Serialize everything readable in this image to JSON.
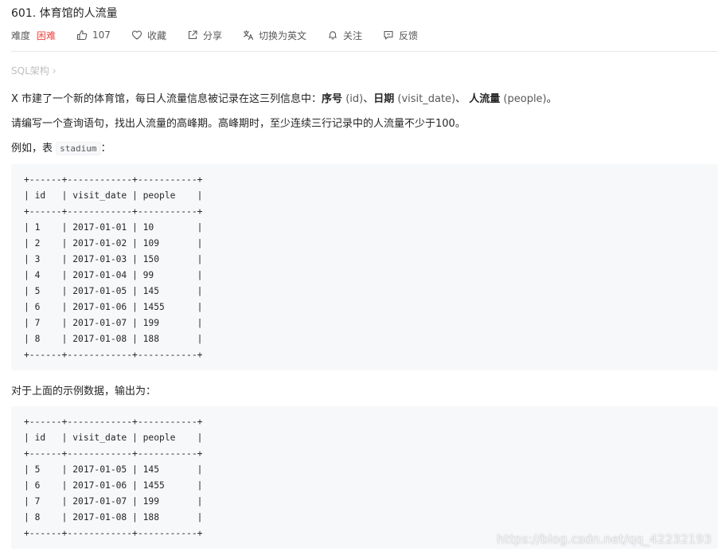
{
  "problem": {
    "title": "601. 体育馆的人流量",
    "difficulty_label": "难度",
    "difficulty_value": "困难",
    "likes": "107",
    "actions": {
      "favorite": "收藏",
      "share": "分享",
      "switch_language": "切换为英文",
      "follow": "关注",
      "feedback": "反馈"
    }
  },
  "breadcrumb": {
    "label": "SQL架构",
    "chevron": "›"
  },
  "description": {
    "p1_prefix": "X 市建了一个新的体育馆，每日人流量信息被记录在这三列信息中：",
    "p1_term1": "序号",
    "p1_term1_paren": " (id)",
    "p1_sep1": "、",
    "p1_term2": "日期",
    "p1_term2_paren": " (visit_date)",
    "p1_sep2": "、 ",
    "p1_term3": "人流量",
    "p1_term3_paren": " (people)",
    "p1_end": "。",
    "p2": "请编写一个查询语句，找出人流量的高峰期。高峰期时，至少连续三行记录中的人流量不少于100。",
    "p3_prefix": "例如，表 ",
    "p3_code": "stadium",
    "p3_suffix": "：",
    "p4": "对于上面的示例数据，输出为："
  },
  "example_table": {
    "text": "+------+------------+-----------+\n| id   | visit_date | people    |\n+------+------------+-----------+\n| 1    | 2017-01-01 | 10        |\n| 2    | 2017-01-02 | 109       |\n| 3    | 2017-01-03 | 150       |\n| 4    | 2017-01-04 | 99        |\n| 5    | 2017-01-05 | 145       |\n| 6    | 2017-01-06 | 1455      |\n| 7    | 2017-01-07 | 199       |\n| 8    | 2017-01-08 | 188       |\n+------+------------+-----------+"
  },
  "output_table": {
    "text": "+------+------------+-----------+\n| id   | visit_date | people    |\n+------+------------+-----------+\n| 5    | 2017-01-05 | 145       |\n| 6    | 2017-01-06 | 1455      |\n| 7    | 2017-01-07 | 199       |\n| 8    | 2017-01-08 | 188       |\n+------+------------+-----------+"
  },
  "watermark": "https://blog.csdn.net/qq_42232193",
  "colors": {
    "difficulty": "#ef4743",
    "muted": "#bfbfbf",
    "code_bg": "#f7f8fa"
  }
}
